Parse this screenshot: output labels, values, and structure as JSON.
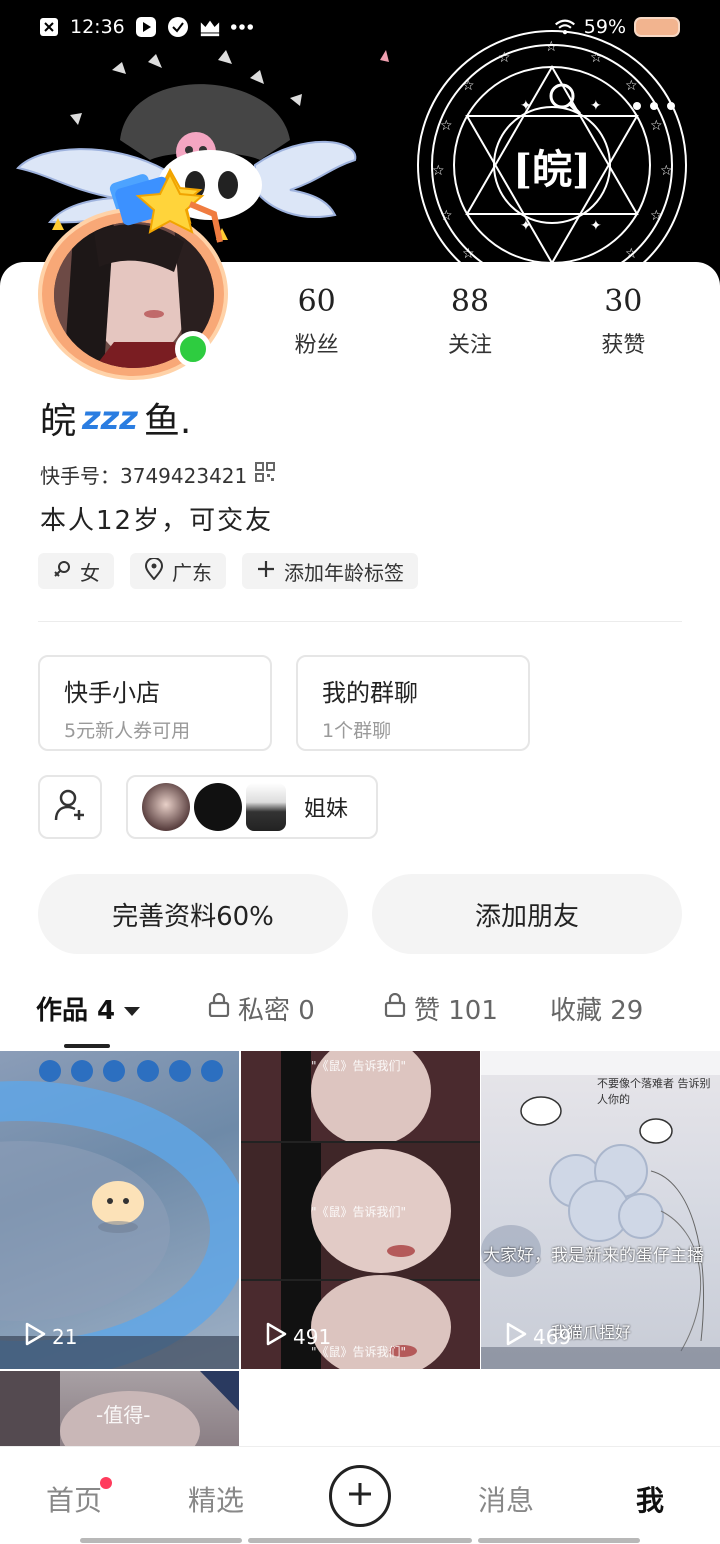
{
  "status_bar": {
    "time": "12:36",
    "battery": "59%",
    "icons": [
      "close-square-icon",
      "play-square-icon",
      "check-circle-icon",
      "crown-icon",
      "more-dots-icon",
      "wifi-icon",
      "battery-icon"
    ]
  },
  "header": {
    "seal_text": "[皖]",
    "actions": [
      "search-icon",
      "more-horizontal-icon"
    ]
  },
  "profile": {
    "stats": [
      {
        "value": "60",
        "label": "粉丝"
      },
      {
        "value": "88",
        "label": "关注"
      },
      {
        "value": "30",
        "label": "获赞"
      }
    ],
    "nickname_start": "皖",
    "nickname_zzz": "zzz",
    "nickname_end": "鱼.",
    "kuaishou_id": "快手号：3749423421",
    "bio": "本人12岁，可交友",
    "tags": [
      {
        "icon": "female-icon",
        "text": "女"
      },
      {
        "icon": "location-pin-icon",
        "text": "广东"
      },
      {
        "icon": "plus-icon",
        "text": "添加年龄标签"
      }
    ]
  },
  "features": [
    {
      "title": "快手小店",
      "subtitle": "5元新人券可用"
    },
    {
      "title": "我的群聊",
      "subtitle": "1个群聊"
    }
  ],
  "group": {
    "name": "姐妹"
  },
  "buttons": {
    "complete_profile": "完善资料60%",
    "add_friends": "添加朋友"
  },
  "tabs": [
    {
      "label": "作品 4",
      "active": true
    },
    {
      "label": "私密 0",
      "active": false
    },
    {
      "label": "赞 101",
      "active": false
    },
    {
      "label": "收藏 29",
      "active": false
    }
  ],
  "posts": [
    {
      "plays": "21"
    },
    {
      "plays": "491",
      "caption": "\"《鼠》告诉我们\""
    },
    {
      "plays": "469",
      "caption_top": "不要像个落难者 告诉别人你的",
      "caption_mid": "大家好，我是新来的蛋仔主播",
      "caption_bottom": "我猫爪捏好"
    },
    {
      "caption": "-值得-"
    }
  ],
  "bottom_nav": [
    {
      "label": "首页",
      "badge": true
    },
    {
      "label": "精选"
    },
    {
      "label": "消息"
    },
    {
      "label": "我",
      "active": true
    }
  ],
  "colors": {
    "accent_red": "#ff3b5c",
    "online_green": "#2ecc40",
    "avatar_ring": "#f8a877",
    "zzz_blue": "#2a7de1"
  }
}
